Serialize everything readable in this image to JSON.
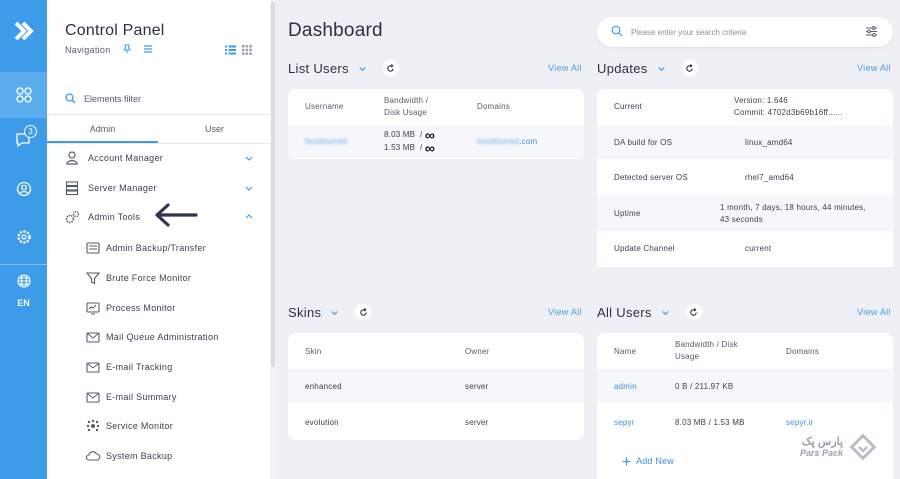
{
  "sidebar": {
    "title": "Control Panel",
    "subtitle": "Navigation",
    "filter_label": "Elements filter",
    "tabs": [
      {
        "label": "Admin"
      },
      {
        "label": "User"
      }
    ],
    "menu": [
      {
        "label": "Account Manager",
        "icon": "user-icon"
      },
      {
        "label": "Server Manager",
        "icon": "server-icon"
      },
      {
        "label": "Admin Tools",
        "icon": "gears-icon"
      }
    ],
    "admin_tools": [
      {
        "label": "Admin Backup/Transfer",
        "icon": "backup-icon"
      },
      {
        "label": "Brute Force Monitor",
        "icon": "filter-icon"
      },
      {
        "label": "Process Monitor",
        "icon": "monitor-icon"
      },
      {
        "label": "Mail Queue Administration",
        "icon": "mail-icon"
      },
      {
        "label": "E-mail Tracking",
        "icon": "mail-icon"
      },
      {
        "label": "E-mail Summary",
        "icon": "mail-icon"
      },
      {
        "label": "Service Monitor",
        "icon": "service-icon"
      },
      {
        "label": "System Backup",
        "icon": "cloud-icon"
      }
    ]
  },
  "rail": {
    "badge_count": "3",
    "language": "EN"
  },
  "header": {
    "title": "Dashboard",
    "search_placeholder": "Please enter your search criteria"
  },
  "list_users": {
    "title": "List Users",
    "view_all": "View All",
    "columns": [
      "Username",
      "Bandwidth /\nDisk Usage",
      "Domains"
    ],
    "row": {
      "username": "hostblurred",
      "bandwidth": "8.03 MB",
      "bandwidth_limit": "∞",
      "disk": "1.53 MB",
      "disk_limit": "∞",
      "domain_blur": "hostblurred",
      "domain_suffix": ".com"
    }
  },
  "updates": {
    "title": "Updates",
    "view_all": "View All",
    "rows": [
      {
        "label": "Current",
        "value": "Version: 1.646",
        "value2": "Commit: 4702d3b69b16ff......"
      },
      {
        "label": "DA build for OS",
        "value": "linux_amd64"
      },
      {
        "label": "Detected server OS",
        "value": "rhel7_amd64"
      },
      {
        "label": "Uptime",
        "value": "1 month, 7 days, 18 hours, 44 minutes,",
        "value2": "43 seconds"
      },
      {
        "label": "Update Channel",
        "value": "current"
      }
    ]
  },
  "skins": {
    "title": "Skins",
    "view_all": "View All",
    "columns": [
      "Skin",
      "Owner"
    ],
    "rows": [
      {
        "skin": "enhanced",
        "owner": "server"
      },
      {
        "skin": "evolution",
        "owner": "server"
      }
    ]
  },
  "all_users": {
    "title": "All Users",
    "view_all": "View All",
    "columns": [
      "Name",
      "Bandwidth / Disk\nUsage",
      "Domains"
    ],
    "rows": [
      {
        "name": "admin",
        "usage": "0 B / 211.97 KB",
        "domain": ""
      },
      {
        "name": "sepyr",
        "usage": "8.03 MB / 1.53 MB",
        "domain": "sepyr.ir"
      }
    ],
    "add_new": "Add New"
  },
  "watermark": {
    "fa": "پارس پک",
    "en": "Pars Pack"
  },
  "colors": {
    "accent": "#3d9be9",
    "link": "#4a9de6",
    "background": "#eef0f5"
  }
}
